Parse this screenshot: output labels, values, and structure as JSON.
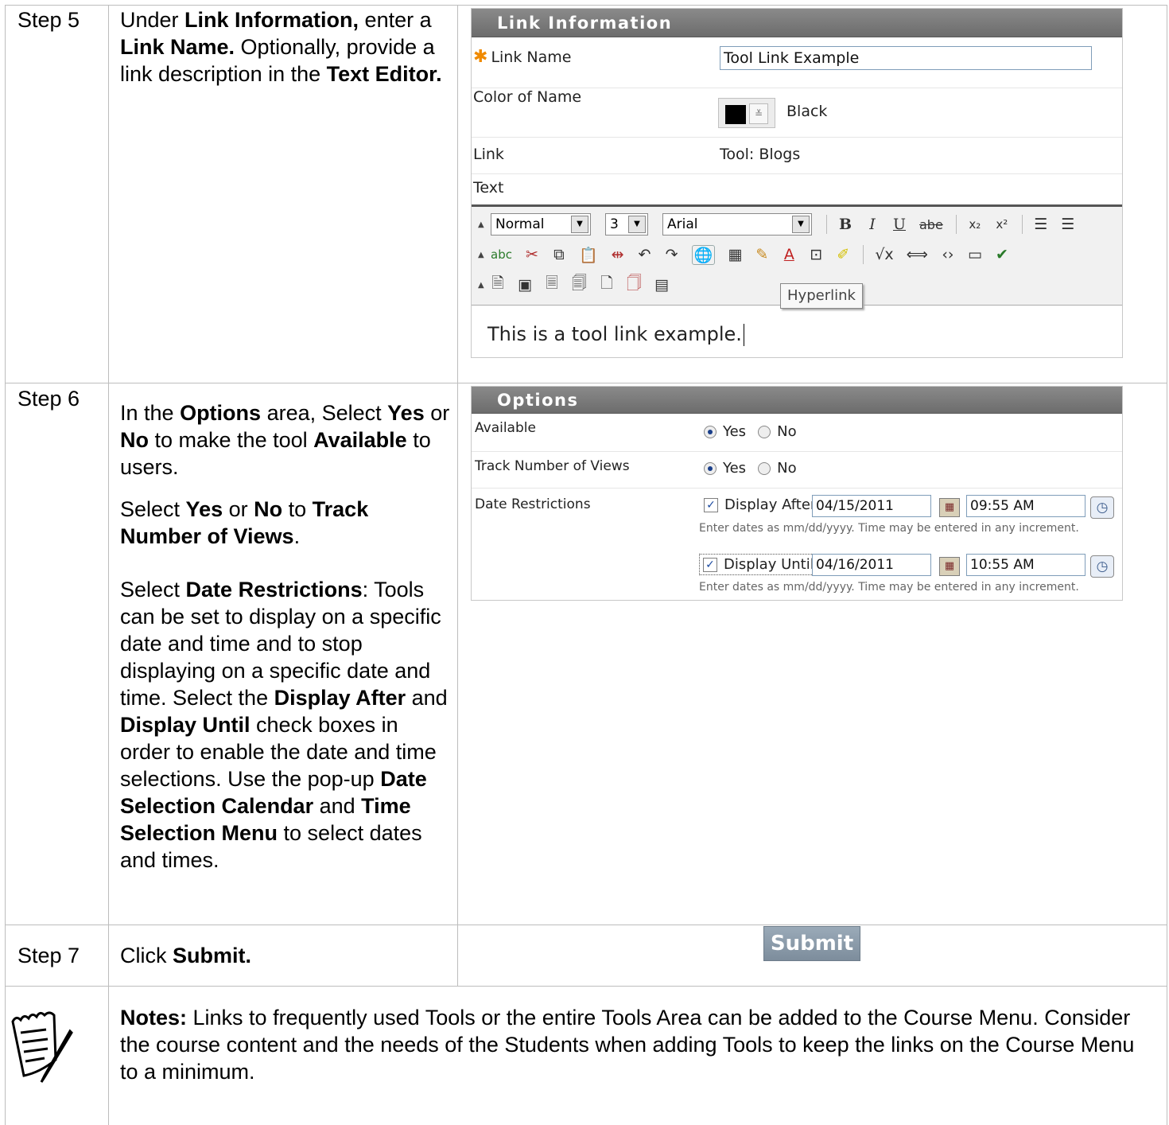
{
  "steps": {
    "step5": {
      "label": "Step 5"
    },
    "step6": {
      "label": "Step 6"
    },
    "step7": {
      "label": "Step 7"
    }
  },
  "step5_text": {
    "t1": "Under ",
    "b1": "Link Information,",
    "t2": " enter a ",
    "b2": "Link Name.",
    "t3": " Optionally, provide a link description in the ",
    "b3": "Text Editor."
  },
  "step6_text": {
    "p1_t1": "In the ",
    "p1_b1": "Options",
    "p1_t2": " area, Select ",
    "p1_b2": "Yes",
    "p1_t3": " or ",
    "p1_b3": "No",
    "p1_t4": " to make the tool ",
    "p1_b4": "Available",
    "p1_t5": " to users.",
    "p2_t1": "Select ",
    "p2_b1": "Yes",
    "p2_t2": " or ",
    "p2_b2": "No",
    "p2_t3": " to ",
    "p2_b3": "Track Number of Views",
    "p2_t4": ".",
    "p3_t1": "Select ",
    "p3_b1": "Date Restrictions",
    "p3_t2": ": Tools can be set to display on a specific date and time and to stop displaying on a specific date and time. Select the ",
    "p3_b2": "Display After",
    "p3_t3": " and ",
    "p3_b3": "Display Until",
    "p3_t4": " check boxes in order to enable the date and time selections. Use the pop-up ",
    "p3_b4": "Date Selection Calendar",
    "p3_t5": " and ",
    "p3_b5": "Time Selection Menu",
    "p3_t6": " to select dates and times."
  },
  "step7_text": {
    "t1": "Click ",
    "b1": "Submit."
  },
  "notes": {
    "b1": "Notes:",
    "t1": " Links to frequently used Tools or the entire Tools Area can be added to the Course Menu. Consider the course content and the needs of the Students when adding Tools to keep the links on the Course Menu to a minimum."
  },
  "link_panel": {
    "title": "Link Information",
    "link_name_label": "Link Name",
    "link_name_value": "Tool Link Example",
    "color_label": "Color of Name",
    "color_value": "Black",
    "link_label": "Link",
    "link_value": "Tool: Blogs",
    "text_label": "Text",
    "editor": {
      "format": "Normal",
      "size": "3",
      "font": "Arial",
      "tooltip": "Hyperlink",
      "content": "This is a tool link example."
    }
  },
  "options_panel": {
    "title": "Options",
    "available_label": "Available",
    "track_label": "Track Number of Views",
    "yes": "Yes",
    "no": "No",
    "date_label": "Date Restrictions",
    "display_after_label": "Display After",
    "display_after_date": "04/15/2011",
    "display_after_time": "09:55 AM",
    "display_until_label": "Display Until",
    "display_until_date": "04/16/2011",
    "display_until_time": "10:55 AM",
    "hint": "Enter dates as mm/dd/yyyy. Time may be entered in any increment."
  },
  "submit_label": "Submit",
  "colors": {
    "header_bg": "#7a7a7a",
    "required_star": "#f08a00",
    "submit_bg": "#8a9aa9"
  }
}
